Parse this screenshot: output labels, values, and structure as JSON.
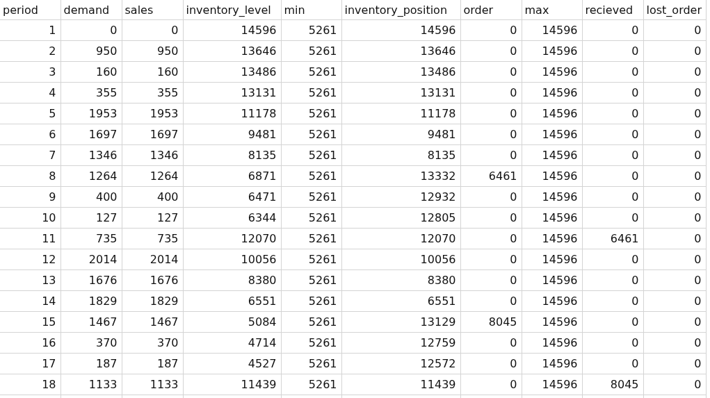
{
  "table": {
    "columns": [
      "period",
      "demand",
      "sales",
      "inventory_level",
      "min",
      "inventory_position",
      "order",
      "max",
      "recieved",
      "lost_order"
    ],
    "rows": [
      [
        "1",
        "0",
        "0",
        "14596",
        "5261",
        "14596",
        "0",
        "14596",
        "0",
        "0"
      ],
      [
        "2",
        "950",
        "950",
        "13646",
        "5261",
        "13646",
        "0",
        "14596",
        "0",
        "0"
      ],
      [
        "3",
        "160",
        "160",
        "13486",
        "5261",
        "13486",
        "0",
        "14596",
        "0",
        "0"
      ],
      [
        "4",
        "355",
        "355",
        "13131",
        "5261",
        "13131",
        "0",
        "14596",
        "0",
        "0"
      ],
      [
        "5",
        "1953",
        "1953",
        "11178",
        "5261",
        "11178",
        "0",
        "14596",
        "0",
        "0"
      ],
      [
        "6",
        "1697",
        "1697",
        "9481",
        "5261",
        "9481",
        "0",
        "14596",
        "0",
        "0"
      ],
      [
        "7",
        "1346",
        "1346",
        "8135",
        "5261",
        "8135",
        "0",
        "14596",
        "0",
        "0"
      ],
      [
        "8",
        "1264",
        "1264",
        "6871",
        "5261",
        "13332",
        "6461",
        "14596",
        "0",
        "0"
      ],
      [
        "9",
        "400",
        "400",
        "6471",
        "5261",
        "12932",
        "0",
        "14596",
        "0",
        "0"
      ],
      [
        "10",
        "127",
        "127",
        "6344",
        "5261",
        "12805",
        "0",
        "14596",
        "0",
        "0"
      ],
      [
        "11",
        "735",
        "735",
        "12070",
        "5261",
        "12070",
        "0",
        "14596",
        "6461",
        "0"
      ],
      [
        "12",
        "2014",
        "2014",
        "10056",
        "5261",
        "10056",
        "0",
        "14596",
        "0",
        "0"
      ],
      [
        "13",
        "1676",
        "1676",
        "8380",
        "5261",
        "8380",
        "0",
        "14596",
        "0",
        "0"
      ],
      [
        "14",
        "1829",
        "1829",
        "6551",
        "5261",
        "6551",
        "0",
        "14596",
        "0",
        "0"
      ],
      [
        "15",
        "1467",
        "1467",
        "5084",
        "5261",
        "13129",
        "8045",
        "14596",
        "0",
        "0"
      ],
      [
        "16",
        "370",
        "370",
        "4714",
        "5261",
        "12759",
        "0",
        "14596",
        "0",
        "0"
      ],
      [
        "17",
        "187",
        "187",
        "4527",
        "5261",
        "12572",
        "0",
        "14596",
        "0",
        "0"
      ],
      [
        "18",
        "1133",
        "1133",
        "11439",
        "5261",
        "11439",
        "0",
        "14596",
        "8045",
        "0"
      ]
    ]
  }
}
